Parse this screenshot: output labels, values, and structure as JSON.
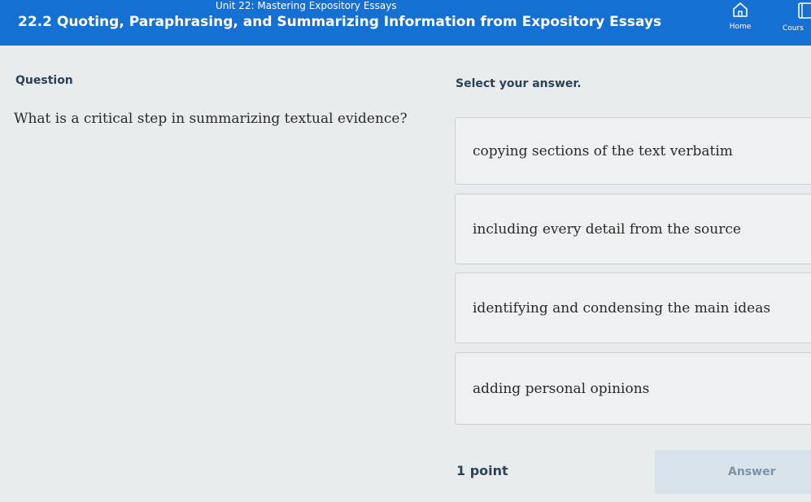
{
  "header": {
    "unit": "Unit 22: Mastering Expository Essays",
    "lesson": "22.2 Quoting, Paraphrasing, and Summarizing Information from Expository Essays",
    "nav": {
      "home_label": "Home",
      "home_icon": "home-icon",
      "courses_label": "Cours",
      "courses_icon": "book-icon"
    },
    "bar_color": "#1570d4"
  },
  "question": {
    "heading": "Question",
    "text": "What is a critical step in summarizing textual evidence?"
  },
  "answers": {
    "prompt": "Select your answer.",
    "choices": [
      {
        "label": "copying sections of the text verbatim"
      },
      {
        "label": "including every detail from the source"
      },
      {
        "label": "identifying and condensing the main ideas"
      },
      {
        "label": "adding personal opinions"
      }
    ]
  },
  "footer": {
    "points": "1 point",
    "answer_label": "Answer"
  }
}
